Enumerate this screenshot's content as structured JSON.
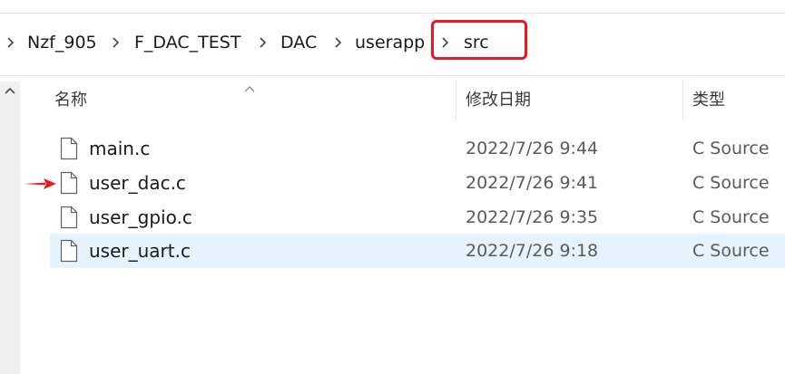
{
  "breadcrumb": {
    "items": [
      {
        "label": "Nzf_905"
      },
      {
        "label": "F_DAC_TEST"
      },
      {
        "label": "DAC"
      },
      {
        "label": "userapp"
      },
      {
        "label": "src"
      }
    ],
    "highlight_color": "#e8191c"
  },
  "columns": {
    "name": "名称",
    "date_modified": "修改日期",
    "type": "类型"
  },
  "files": [
    {
      "name": "main.c",
      "date": "2022/7/26 9:44",
      "type": "C Source",
      "icon": "file-icon"
    },
    {
      "name": "user_dac.c",
      "date": "2022/7/26 9:41",
      "type": "C Source",
      "icon": "file-icon"
    },
    {
      "name": "user_gpio.c",
      "date": "2022/7/26 9:35",
      "type": "C Source",
      "icon": "file-icon"
    },
    {
      "name": "user_uart.c",
      "date": "2022/7/26 9:18",
      "type": "C Source",
      "icon": "file-icon",
      "selected": true
    }
  ],
  "annotation": {
    "icon": "red-arrow-icon",
    "color": "#e8191c"
  },
  "colors": {
    "selection": "#e5f3ff"
  }
}
